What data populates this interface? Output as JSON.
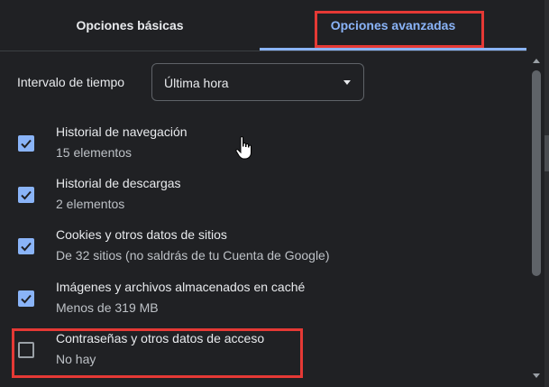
{
  "tabs": {
    "basic": "Opciones básicas",
    "advanced": "Opciones avanzadas",
    "active": "advanced"
  },
  "time_range": {
    "label": "Intervalo de tiempo",
    "value": "Última hora"
  },
  "options": [
    {
      "title": "Historial de navegación",
      "subtitle": "15 elementos",
      "checked": true
    },
    {
      "title": "Historial de descargas",
      "subtitle": "2 elementos",
      "checked": true
    },
    {
      "title": "Cookies y otros datos de sitios",
      "subtitle": "De 32 sitios (no saldrás de tu Cuenta de Google)",
      "checked": true
    },
    {
      "title": "Imágenes y archivos almacenados en caché",
      "subtitle": "Menos de 319 MB",
      "checked": true
    },
    {
      "title": "Contraseñas y otros datos de acceso",
      "subtitle": "No hay",
      "checked": false
    }
  ],
  "colors": {
    "background": "#202124",
    "accent": "#8ab4f8",
    "highlight": "#e53935",
    "text": "#e8eaed",
    "subtext": "#bdc1c6"
  },
  "icons": {
    "checkbox_checked": "check-icon",
    "dropdown": "chevron-down-icon",
    "cursor": "hand-pointer-icon"
  }
}
